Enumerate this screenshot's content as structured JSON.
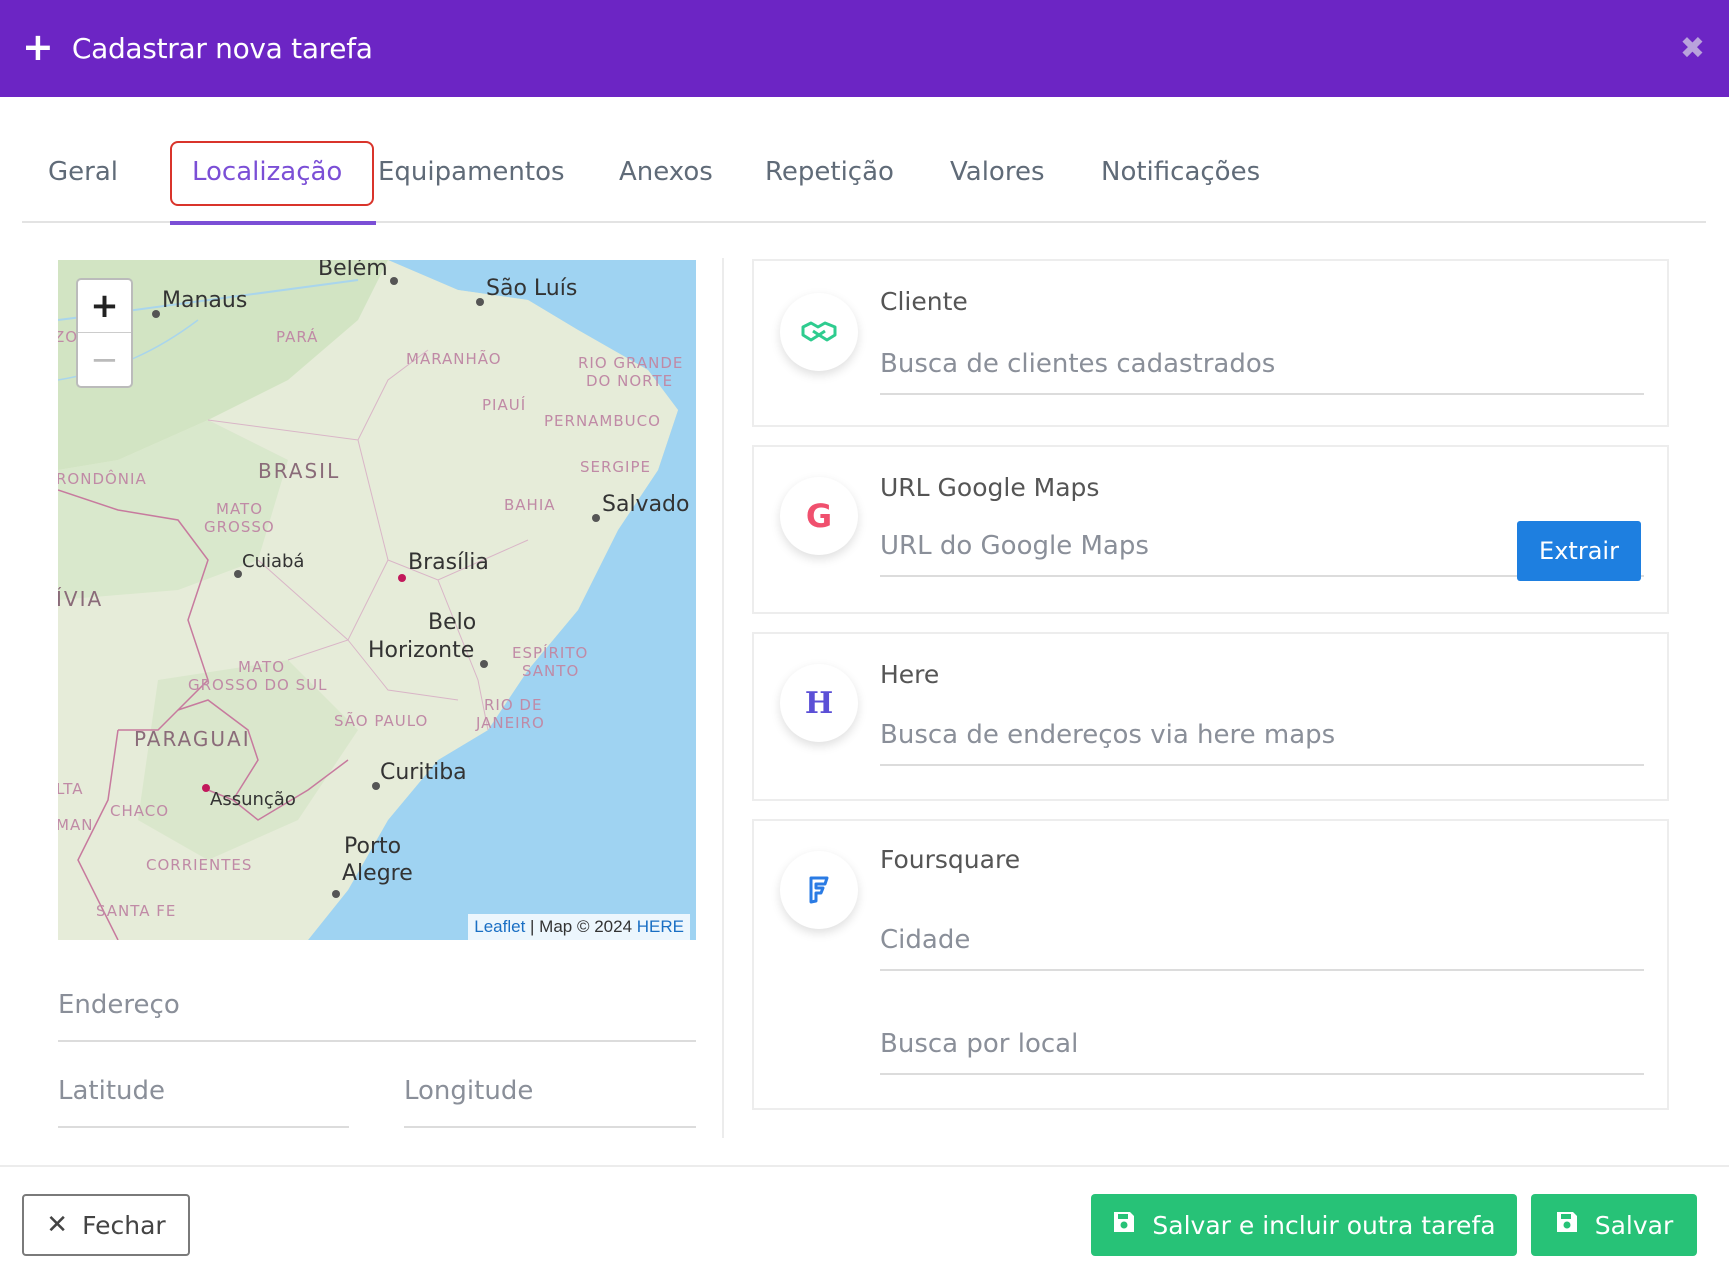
{
  "header": {
    "title": "Cadastrar nova tarefa",
    "plus_icon": "+",
    "close_icon": "✖"
  },
  "tabs": [
    {
      "label": "Geral"
    },
    {
      "label": "Localização",
      "active": true
    },
    {
      "label": "Equipamentos"
    },
    {
      "label": "Anexos"
    },
    {
      "label": "Repetição"
    },
    {
      "label": "Valores"
    },
    {
      "label": "Notificações"
    }
  ],
  "map": {
    "zoom_in": "+",
    "zoom_out": "−",
    "attribution": {
      "leaflet": "Leaflet",
      "sep": " | Map © 2024 ",
      "here": "HERE"
    },
    "cities": {
      "belem": "Belém",
      "manaus": "Manaus",
      "sao_luis": "São Luís",
      "salvador": "Salvado",
      "brasilia": "Brasília",
      "cuiaba": "Cuiabá",
      "belo_horizonte_1": "Belo",
      "belo_horizonte_2": "Horizonte",
      "curitiba": "Curitiba",
      "porto_alegre_1": "Porto",
      "porto_alegre_2": "Alegre",
      "assuncao": "Assunção",
      "brasil": "BRASIL",
      "paraguai": "PARAGUAI",
      "bolivia": "ÍVIA"
    },
    "regions": {
      "para": "PARÁ",
      "maranhao": "MARANHÃO",
      "rio_grande_do_norte_1": "RIO GRANDE",
      "rio_grande_do_norte_2": "DO NORTE",
      "piaui": "PIAUÍ",
      "pernambuco": "PERNAMBUCO",
      "sergipe": "SERGIPE",
      "bahia": "BAHIA",
      "rondonia": "RONDÔNIA",
      "mato_grosso_1": "MATO",
      "mato_grosso_2": "GROSSO",
      "espirito_santo_1": "ESPÍRITO",
      "espirito_santo_2": "SANTO",
      "mato_grosso_do_sul_1": "MATO",
      "mato_grosso_do_sul_2": "GROSSO DO SUL",
      "sao_paulo": "SÃO PAULO",
      "rio_de_janeiro_1": "RIO DE",
      "rio_de_janeiro_2": "JANEIRO",
      "chaco": "CHACO",
      "corrientes": "CORRIENTES",
      "santa_fe": "SANTA FE",
      "zo": "ZO",
      "lta": "LTA",
      "man": "MAN"
    }
  },
  "fields": {
    "address": "Endereço",
    "latitude": "Latitude",
    "longitude": "Longitude"
  },
  "cards": {
    "client": {
      "label": "Cliente",
      "placeholder": "Busca de clientes cadastrados",
      "icon": "handshake-icon",
      "color": "#2ecc8f"
    },
    "google": {
      "label": "URL Google Maps",
      "placeholder": "URL do Google Maps",
      "button": "Extrair",
      "icon_text": "G",
      "color": "#f0506e"
    },
    "here": {
      "label": "Here",
      "placeholder": "Busca de endereços via here maps",
      "icon_text": "H",
      "color": "#5b4fd6"
    },
    "foursquare": {
      "label": "Foursquare",
      "placeholder_city": "Cidade",
      "placeholder_local": "Busca por local",
      "icon": "foursquare-icon",
      "color": "#2a7be4"
    }
  },
  "footer": {
    "close_label": "Fechar",
    "close_icon": "✕",
    "save_and_new_label": "Salvar e incluir outra tarefa",
    "save_label": "Salvar"
  }
}
